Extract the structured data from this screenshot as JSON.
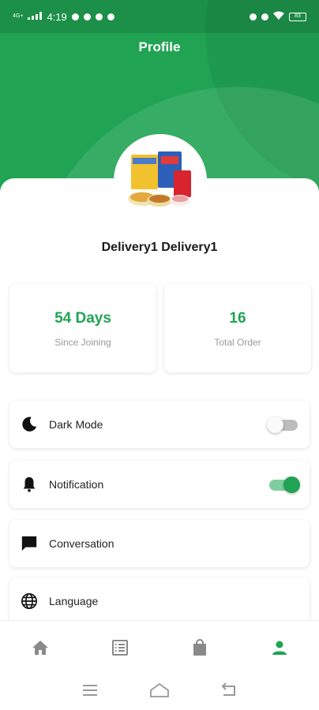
{
  "status_bar": {
    "time": "4:19",
    "left_text": "4G+",
    "battery": "83"
  },
  "header": {
    "title": "Profile"
  },
  "user": {
    "name": "Delivery1 Delivery1",
    "avatar_icon": "product-boxes-image"
  },
  "stats": [
    {
      "value": "54 Days",
      "label": "Since Joining"
    },
    {
      "value": "16",
      "label": "Total Order"
    }
  ],
  "settings": [
    {
      "label": "Dark Mode",
      "icon": "moon-icon",
      "toggle": false
    },
    {
      "label": "Notification",
      "icon": "bell-icon",
      "toggle": true
    },
    {
      "label": "Conversation",
      "icon": "chat-icon"
    },
    {
      "label": "Language",
      "icon": "globe-icon"
    }
  ],
  "bottom_nav": [
    {
      "name": "home",
      "icon": "home-icon",
      "active": false
    },
    {
      "name": "orders",
      "icon": "list-icon",
      "active": false
    },
    {
      "name": "bag",
      "icon": "bag-icon",
      "active": false
    },
    {
      "name": "profile",
      "icon": "person-icon",
      "active": true
    }
  ],
  "colors": {
    "primary": "#20a353",
    "inactive_icon": "#8a8a8a"
  }
}
